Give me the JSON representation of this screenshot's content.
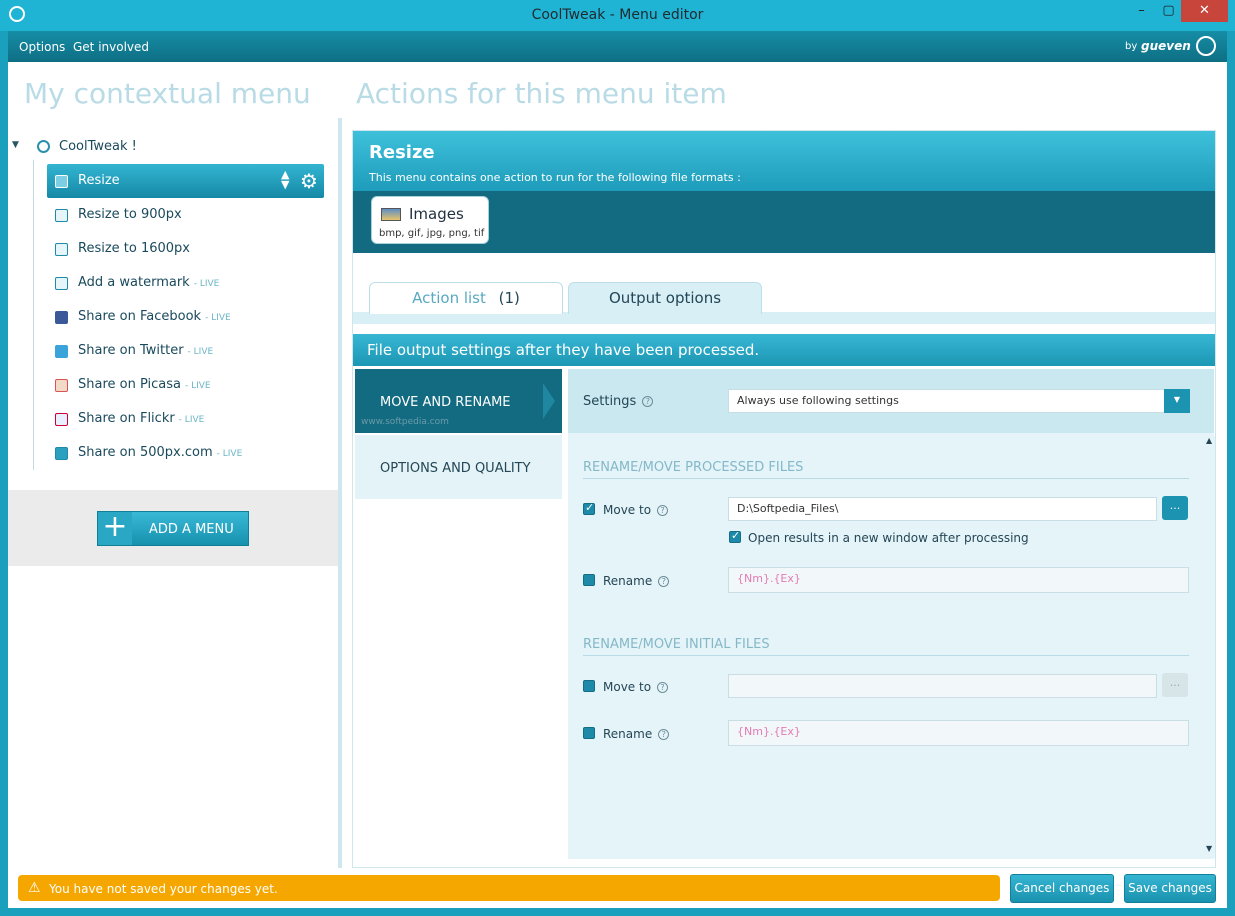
{
  "window": {
    "title": "CoolTweak - Menu editor",
    "minimize": "–",
    "maximize": "▢",
    "close": "✕"
  },
  "menubar": {
    "options": "Options",
    "get_involved": "Get involved",
    "brand_by": "by",
    "brand_name": "gueven"
  },
  "sidebar": {
    "heading": "My contextual menu",
    "root": "CoolTweak !",
    "items": [
      {
        "label": "Resize",
        "live": ""
      },
      {
        "label": "Resize to 900px",
        "live": ""
      },
      {
        "label": "Resize to 1600px",
        "live": ""
      },
      {
        "label": "Add a watermark",
        "live": "- LIVE"
      },
      {
        "label": "Share on Facebook",
        "live": "- LIVE"
      },
      {
        "label": "Share on Twitter",
        "live": "- LIVE"
      },
      {
        "label": "Share on Picasa",
        "live": "- LIVE"
      },
      {
        "label": "Share on Flickr",
        "live": "- LIVE"
      },
      {
        "label": "Share on 500px.com",
        "live": "- LIVE"
      }
    ],
    "add_menu": "ADD A MENU"
  },
  "main": {
    "heading": "Actions for this menu item",
    "item_title": "Resize",
    "item_subtitle": "This menu contains one action to run for the following file formats :",
    "format_name": "Images",
    "format_exts": "bmp, gif, jpg, png, tif",
    "tabs": [
      {
        "label": "Action list",
        "count": "(1)"
      },
      {
        "label": "Output options"
      }
    ],
    "output_header": "File output settings after they have been processed.",
    "nav": [
      "MOVE AND RENAME",
      "OPTIONS AND QUALITY"
    ],
    "settings_label": "Settings",
    "settings_value": "Always use following settings",
    "section1": "RENAME/MOVE PROCESSED FILES",
    "move_to_label": "Move to",
    "move_to_value": "D:\\Softpedia_Files\\",
    "browse_label": "...",
    "open_results": "Open results in a new window after processing",
    "rename_label": "Rename",
    "rename_value": "{Nm}.{Ex}",
    "section2": "RENAME/MOVE INITIAL FILES",
    "move_to2_label": "Move to",
    "move_to2_value": "",
    "rename2_label": "Rename",
    "rename2_value": "{Nm}.{Ex}",
    "watermark": "SOFTPEDIA",
    "watermark_url": "www.softpedia.com"
  },
  "footer": {
    "warning": "You have not saved your changes yet.",
    "cancel": "Cancel changes",
    "save": "Save changes"
  },
  "colors": {
    "accent": "#1aa0bc",
    "dark": "#136b81",
    "warning": "#f5a700"
  }
}
